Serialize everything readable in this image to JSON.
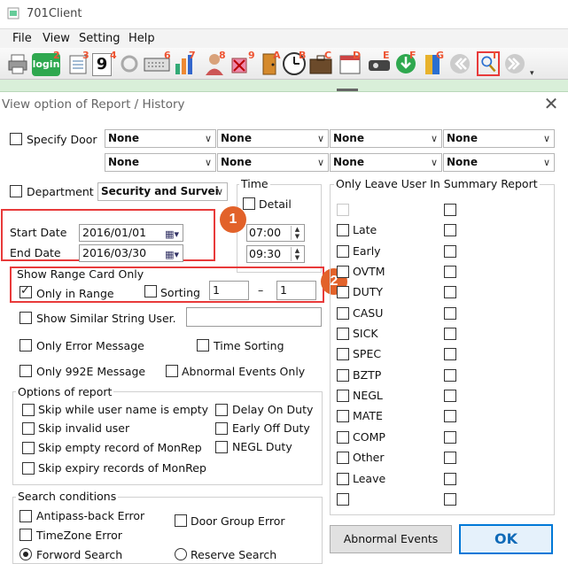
{
  "app": {
    "title": "701Client",
    "menu": [
      "File",
      "View",
      "Setting",
      "Help"
    ],
    "toolbar_numbers": [
      "2",
      "3",
      "4",
      "6",
      "7",
      "8",
      "9",
      "A",
      "B",
      "C",
      "D",
      "E",
      "F",
      "G",
      "I"
    ],
    "toolbar_icons": [
      "printer-icon",
      "login-icon",
      "list-icon",
      "nine-icon",
      "refresh-icon",
      "keyboard-icon",
      "chart-icon",
      "user-icon",
      "delete-icon",
      "door-icon",
      "clock-icon",
      "briefcase-icon",
      "calendar-icon",
      "card-reader-icon",
      "download-icon",
      "book-icon",
      "back-icon",
      "search-user-icon",
      "forward-icon"
    ],
    "login_label": "login",
    "nine_label": "9"
  },
  "dialog": {
    "title": "View option of Report / History",
    "close": "✕",
    "specify_door": {
      "label": "Specify Door",
      "checked": false,
      "doors": [
        "None",
        "None",
        "None",
        "None",
        "None",
        "None",
        "None",
        "None"
      ]
    },
    "department": {
      "label": "Department",
      "checked": false,
      "value": "Security and Survei"
    },
    "time": {
      "label": "Time",
      "detail_label": "Detail",
      "detail_checked": false,
      "start_time": "07:00",
      "end_time": "09:30"
    },
    "start_date": {
      "label": "Start Date",
      "value": "2016/01/01"
    },
    "end_date": {
      "label": "End Date",
      "value": "2016/03/30"
    },
    "annotations": [
      "1",
      "2"
    ],
    "range": {
      "legend": "Show Range Card Only",
      "only_in_range_label": "Only in Range",
      "only_in_range_checked": true,
      "sorting_label": "Sorting",
      "sorting_checked": false,
      "from": "1",
      "dash": "–",
      "to": "1"
    },
    "similar_string": {
      "label": "Show Similar String User.",
      "checked": false,
      "value": ""
    },
    "only_error": {
      "label": "Only Error Message",
      "checked": false
    },
    "time_sorting": {
      "label": "Time Sorting",
      "checked": false
    },
    "only_992e": {
      "label": "Only 992E Message",
      "checked": false
    },
    "abnormal_only": {
      "label": "Abnormal Events Only",
      "checked": false
    },
    "options": {
      "legend": "Options of report",
      "skip_empty_name": "Skip while user name is empty",
      "skip_invalid": "Skip invalid user",
      "skip_empty_monrep": "Skip empty record of MonRep",
      "skip_expiry_monrep": "Skip expiry records of MonRep",
      "delay_on_duty": "Delay On Duty",
      "early_off_duty": "Early Off Duty",
      "negl_duty": "NEGL Duty"
    },
    "search": {
      "legend": "Search conditions",
      "antipass": "Antipass-back Error",
      "door_group": "Door Group Error",
      "timezone": "TimeZone Error",
      "forward": "Forword Search",
      "reserve": "Reserve Search",
      "selected": "forward"
    },
    "leave": {
      "legend": "Only Leave User In Summary Report",
      "items": [
        "",
        "Late",
        "Early",
        "OVTM",
        "DUTY",
        "CASU",
        "SICK",
        "SPEC",
        "BZTP",
        "NEGL",
        "MATE",
        "COMP",
        "Other",
        "Leave",
        ""
      ]
    },
    "buttons": {
      "abnormal": "Abnormal Events",
      "ok": "OK"
    },
    "colors": {
      "annotation": "#e2622a",
      "highlight_box": "#e83a3a",
      "ok_border": "#0078d7"
    }
  }
}
